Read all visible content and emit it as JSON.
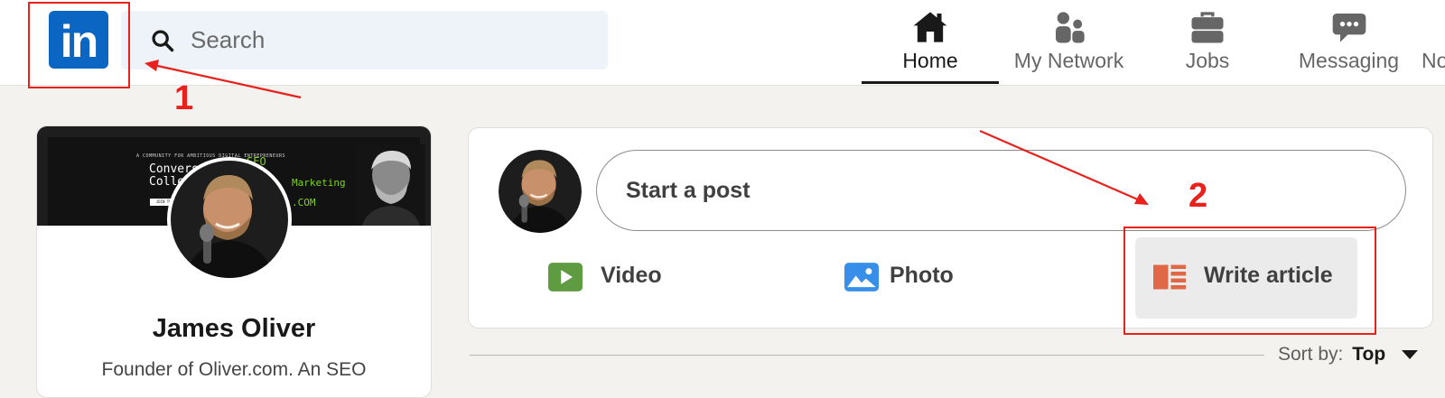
{
  "nav": {
    "logo_text": "in",
    "search_placeholder": "Search",
    "items": [
      {
        "label": "Home",
        "icon": "home-icon",
        "active": true
      },
      {
        "label": "My Network",
        "icon": "network-icon",
        "active": false
      },
      {
        "label": "Jobs",
        "icon": "briefcase-icon",
        "active": false
      },
      {
        "label": "Messaging",
        "icon": "chat-icon",
        "active": false
      },
      {
        "label": "No",
        "icon": "bell-icon",
        "active": false
      }
    ]
  },
  "profile": {
    "name": "James Oliver",
    "headline": "Founder of Oliver.com. An SEO",
    "banner": {
      "small_text": "A COMMUNITY FOR AMBITIOUS DIGITAL ENTREPRENEURS",
      "line1": "Conversion",
      "line2": "Collect",
      "seo": "SEO",
      "marketing": "Marketing",
      "com": ".COM",
      "join": "JOIN THE CO"
    }
  },
  "share": {
    "start_post": "Start a post",
    "actions": [
      {
        "label": "Video",
        "icon": "video-icon",
        "color": "#5f9b41"
      },
      {
        "label": "Photo",
        "icon": "photo-icon",
        "color": "#378fe9"
      },
      {
        "label": "Write article",
        "icon": "article-icon",
        "color": "#e06847"
      }
    ]
  },
  "sort": {
    "label": "Sort by:",
    "value": "Top"
  },
  "annotations": {
    "step1": "1",
    "step2": "2",
    "color": "#e8211c"
  },
  "colors": {
    "brand": "#0a66c2",
    "background": "#f4f2ee"
  }
}
